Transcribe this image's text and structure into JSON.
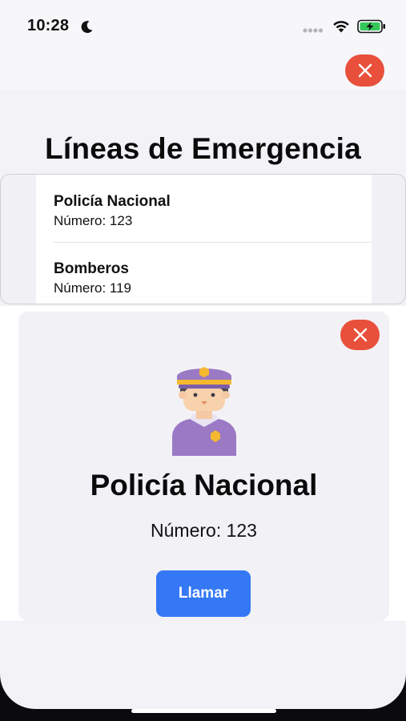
{
  "status_bar": {
    "time": "10:28",
    "icons": [
      "moon-icon",
      "cellular-signal-icon",
      "wifi-icon",
      "battery-charging-icon"
    ]
  },
  "header": {
    "close_icon": "close-icon",
    "title": "Líneas de Emergencia"
  },
  "emergency_list": {
    "items": [
      {
        "name": "Policía Nacional",
        "number": "Número: 123"
      },
      {
        "name": "Bomberos",
        "number": "Número: 119"
      }
    ]
  },
  "detail": {
    "close_icon": "close-icon",
    "icon": "police-officer-icon",
    "name": "Policía Nacional",
    "number": "Número: 123",
    "call_label": "Llamar"
  },
  "colors": {
    "accent_blue": "#3478f6",
    "close_red": "#e8503c",
    "background": "#f2f2f7",
    "police_purple": "#9b79c4"
  }
}
